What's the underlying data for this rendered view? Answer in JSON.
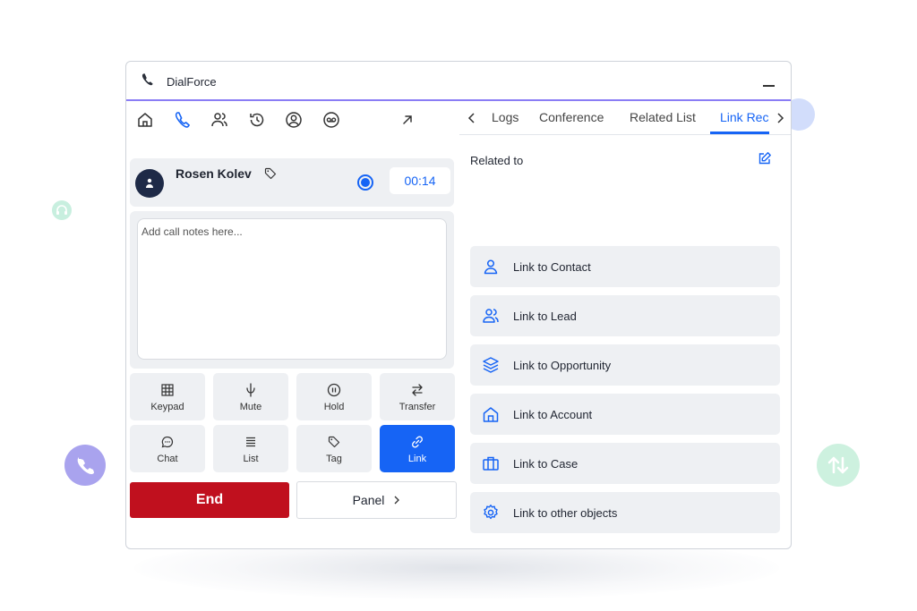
{
  "window": {
    "title": "DialForce"
  },
  "nav": {
    "icons": [
      "home-icon",
      "phone-icon",
      "contacts-icon",
      "history-icon",
      "user-circle-icon",
      "voicemail-icon",
      "expand-icon"
    ]
  },
  "call": {
    "caller_name": "Rosen Kolev",
    "timer": "00:14",
    "notes_placeholder": "Add call notes here..."
  },
  "controls": {
    "buttons": [
      {
        "label": "Keypad",
        "icon": "keypad-icon"
      },
      {
        "label": "Mute",
        "icon": "mute-icon"
      },
      {
        "label": "Hold",
        "icon": "hold-icon"
      },
      {
        "label": "Transfer",
        "icon": "transfer-icon"
      },
      {
        "label": "Chat",
        "icon": "chat-icon"
      },
      {
        "label": "List",
        "icon": "list-icon"
      },
      {
        "label": "Tag",
        "icon": "tag-icon"
      },
      {
        "label": "Link",
        "icon": "link-icon",
        "active": true
      }
    ],
    "end_label": "End",
    "panel_label": "Panel"
  },
  "tabs": [
    {
      "label": "Logs"
    },
    {
      "label": "Conference"
    },
    {
      "label": "Related List"
    },
    {
      "label": "Link Rec",
      "active": true
    }
  ],
  "related": {
    "title": "Related to",
    "items": [
      {
        "label": "Link to Contact",
        "icon": "person-icon"
      },
      {
        "label": "Link to Lead",
        "icon": "people-icon"
      },
      {
        "label": "Link to Opportunity",
        "icon": "layers-icon"
      },
      {
        "label": "Link to Account",
        "icon": "building-icon"
      },
      {
        "label": "Link to Case",
        "icon": "briefcase-icon"
      },
      {
        "label": "Link to other objects",
        "icon": "settings-icon"
      }
    ]
  },
  "colors": {
    "accent": "#1664f5",
    "end": "#c0101e",
    "title_border": "#8a7df5",
    "panel_bg": "#eef0f3"
  }
}
